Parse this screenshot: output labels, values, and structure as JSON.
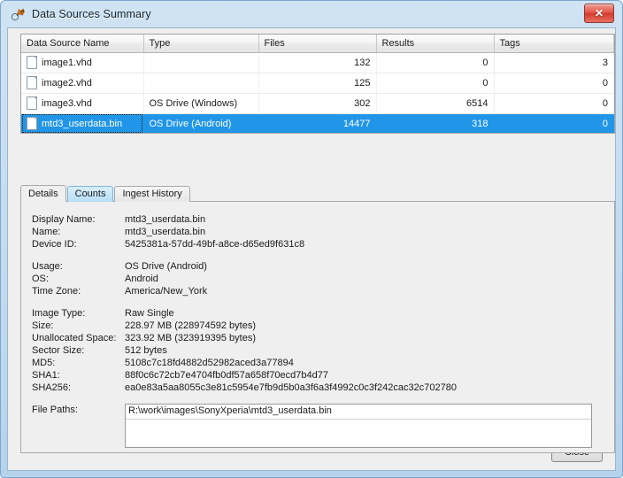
{
  "window": {
    "title": "Data Sources Summary",
    "app_icon": "autopsy-app-icon",
    "close_icon": "close-icon",
    "close_glyph": "✕"
  },
  "table": {
    "columns": [
      "Data Source Name",
      "Type",
      "Files",
      "Results",
      "Tags"
    ],
    "rows": [
      {
        "name": "image1.vhd",
        "type": "",
        "files": "132",
        "results": "0",
        "tags": "3",
        "selected": false
      },
      {
        "name": "image2.vhd",
        "type": "",
        "files": "125",
        "results": "0",
        "tags": "0",
        "selected": false
      },
      {
        "name": "image3.vhd",
        "type": "OS Drive (Windows)",
        "files": "302",
        "results": "6514",
        "tags": "0",
        "selected": false
      },
      {
        "name": "mtd3_userdata.bin",
        "type": "OS Drive (Android)",
        "files": "14477",
        "results": "318",
        "tags": "0",
        "selected": true
      }
    ]
  },
  "tabs": [
    {
      "label": "Details",
      "state": "active"
    },
    {
      "label": "Counts",
      "state": "hover"
    },
    {
      "label": "Ingest History",
      "state": "normal"
    }
  ],
  "details": {
    "group1": [
      {
        "key": "Display Name:",
        "value": "mtd3_userdata.bin"
      },
      {
        "key": "Name:",
        "value": "mtd3_userdata.bin"
      },
      {
        "key": "Device ID:",
        "value": "5425381a-57dd-49bf-a8ce-d65ed9f631c8"
      }
    ],
    "group2": [
      {
        "key": "Usage:",
        "value": "OS Drive (Android)"
      },
      {
        "key": "OS:",
        "value": "Android"
      },
      {
        "key": "Time Zone:",
        "value": "America/New_York"
      }
    ],
    "group3": [
      {
        "key": "Image Type:",
        "value": "Raw Single"
      },
      {
        "key": "Size:",
        "value": "228.97 MB (228974592 bytes)"
      },
      {
        "key": "Unallocated Space:",
        "value": "323.92 MB (323919395 bytes)"
      },
      {
        "key": "Sector Size:",
        "value": "512 bytes"
      },
      {
        "key": "MD5:",
        "value": "5108c7c18fd4882d52982aced3a77894"
      },
      {
        "key": "SHA1:",
        "value": "88f0c6c72cb7e4704fb0df57a658f70ecd7b4d77"
      },
      {
        "key": "SHA256:",
        "value": "ea0e83a5aa8055c3e81c5954e7fb9d5b0a3f6a3f4992c0c3f242cac32c702780"
      }
    ],
    "file_paths_label": "File Paths:",
    "file_paths": [
      "R:\\work\\images\\SonyXperia\\mtd3_userdata.bin"
    ]
  },
  "footer": {
    "close_label": "Close"
  },
  "colors": {
    "selection_blue": "#2196e8",
    "tab_hover_blue": "#b6dff6",
    "window_frame": "#b6d3ec",
    "close_red": "#d33c2e"
  }
}
